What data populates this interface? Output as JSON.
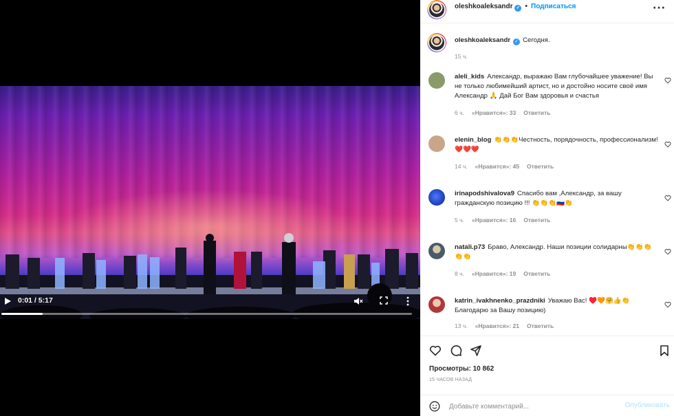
{
  "video": {
    "time": "0:01 / 5:17",
    "progress": 0.1
  },
  "header": {
    "username": "oleshkoaleksandr",
    "follow_label": "Подписаться",
    "verified_mark": "✓"
  },
  "caption": {
    "username": "oleshkoaleksandr",
    "text": "Сегодня.",
    "time": "15 ч."
  },
  "comments": [
    {
      "user": "aleli_kids",
      "text": "Александр, выражаю Вам глубочайшее уважение! Вы не только любимейший артист, но и достойно носите своё имя Александр 🙏 Дай Бог Вам здоровья и счастья",
      "time": "6 ч.",
      "likes": "«Нравится»: 33",
      "reply": "Ответить",
      "avatar_color": "#8a9a6a"
    },
    {
      "user": "elenin_blog",
      "text": "👏👏👏Честность, порядочность, профессионализм!❤️❤️❤️",
      "time": "14 ч.",
      "likes": "«Нравится»: 45",
      "reply": "Ответить",
      "avatar_color": "#c9a58a"
    },
    {
      "user": "irinapodshivalova9",
      "text": "Спасибо вам ,Александр, за вашу гражданскую позицию !!! 👏👏👏🇷🇺👏",
      "time": "5 ч.",
      "likes": "«Нравится»: 16",
      "reply": "Ответить",
      "avatar_color": "#1d3fd0"
    },
    {
      "user": "natali.p73",
      "text": "Браво, Александр. Наши позиции солидарны👏👏👏👏👏",
      "time": "8 ч.",
      "likes": "«Нравится»: 19",
      "reply": "Ответить",
      "avatar_color": "#4a5a6a"
    },
    {
      "user": "katrin_ivakhnenko_prazdniki",
      "text": "Уважаю Вас! ♥️🧡🤗👍👏 Благодарю за Вашу позицию)",
      "time": "13 ч.",
      "likes": "«Нравится»: 21",
      "reply": "Ответить",
      "avatar_color": "#b0383a"
    }
  ],
  "stats": {
    "views": "Просмотры: 10 862",
    "posted": "15 ЧАСОВ НАЗАД"
  },
  "add_comment": {
    "placeholder": "Добавьте комментарий...",
    "publish_label": "Опубликовать"
  },
  "colors": {
    "accent": "#0095f6",
    "verified": "#3897f0",
    "muted": "#8e8e8e",
    "publish_disabled": "#b2dffc"
  },
  "icons": [
    "play-icon",
    "mute-icon",
    "fullscreen-icon",
    "more-vertical-icon",
    "more-horizontal-icon",
    "heart-icon",
    "comment-icon",
    "share-icon",
    "bookmark-icon",
    "emoji-icon",
    "verified-icon"
  ]
}
